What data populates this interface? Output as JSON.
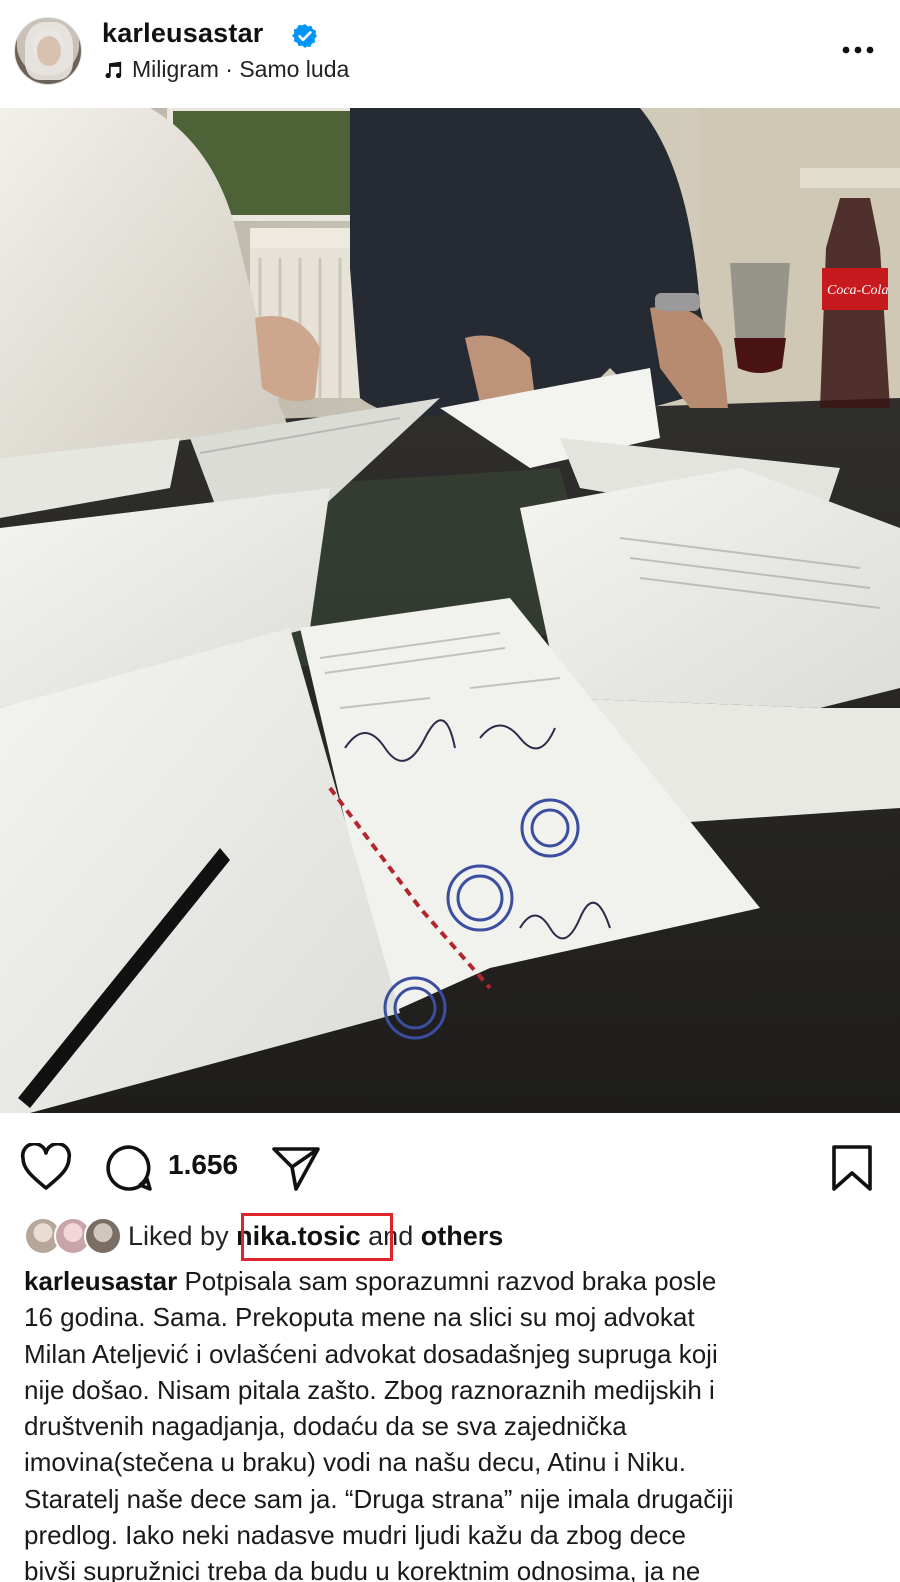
{
  "post": {
    "username": "karleusastar",
    "music": "Miligram · Samo luda",
    "comment_count": "1.656",
    "likes": {
      "prefix": "Liked by",
      "user": "nika.tosic",
      "middle": "and",
      "suffix": "others"
    },
    "caption_lines": [
      "Potpisala sam sporazumni razvod braka posle",
      "16 godina. Sama. Prekoputa mene na slici su moj advokat",
      "Milan Ateljević i ovlašćeni advokat dosadašnjeg supruga koji",
      "nije došao. Nisam pitala zašto. Zbog raznoraznih medijskih i",
      "društvenih nagadjanja, dodaću da se sva zajednička",
      "imovina(stečena u braku) vodi na našu decu, Atinu i Niku.",
      "Staratelj naše dece sam ja. “Druga strana” nije imala drugačiji",
      "predlog. Iako neki nadasve mudri ljudi kažu da zbog dece",
      "bivši supružnici treba da budu u korektnim odnosima, ja ne"
    ]
  },
  "icons": {
    "verified": "verified-badge-icon",
    "music": "music-note-icon",
    "more": "more-options-icon",
    "like": "heart-icon",
    "comment": "comment-bubble-icon",
    "share": "paper-plane-icon",
    "save": "bookmark-icon",
    "sound": "speaker-icon"
  },
  "photo": {
    "bottle_label": "Coca-Cola"
  },
  "colors": {
    "verified_blue": "#0095f6",
    "highlight_red": "#e0242b",
    "text": "#111111"
  }
}
